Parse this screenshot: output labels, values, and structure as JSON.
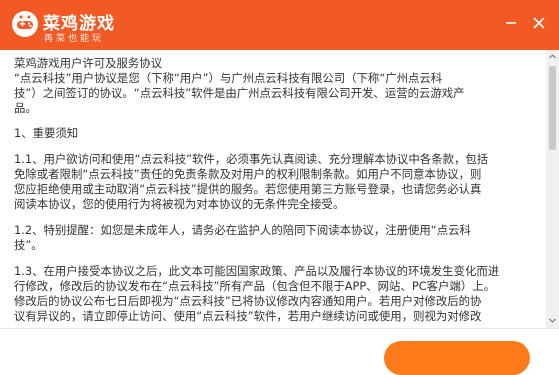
{
  "titlebar": {
    "brand_name": "菜鸡游戏",
    "slogan": "再菜也能玩",
    "accent_color": "#f15a24",
    "icons": [
      "game-controller-logo-icon",
      "minimize-icon",
      "close-icon"
    ]
  },
  "agreement": {
    "lines": [
      "菜鸡游戏用户许可及服务协议",
      "“点云科技”用户协议是您（下称“用户”）与广州点云科技有限公司（下称“广州点云科",
      "技”）之间签订的协议。“点云科技”软件是由广州点云科技有限公司开发、运营的云游戏产",
      "品。",
      "1、重要须知",
      "1.1、用户欲访问和使用“点云科技”软件，必须事先认真阅读、充分理解本协议中各条款，包括",
      "免除或者限制“点云科技”责任的免责条款及对用户的权利限制条款。如用户不同意本协议，则",
      "您应拒绝使用或主动取消“点云科技”提供的服务。若您使用第三方账号登录，也请您务必认真",
      "阅读本协议，您的使用行为将被视为对本协议的无条件完全接受。",
      "1.2、特别提醒：如您是未成年人，请务必在监护人的陪同下阅读本协议，注册使用“点云科",
      "技”。",
      "1.3、在用户接受本协议之后，此文本可能因国家政策、产品以及履行本协议的环境发生变化而进",
      "行修改，修改后的协议发布在“点云科技”所有产品（包含但不限于APP、网站、PC客户端）上。",
      "修改后的协议公布七日后即视为“点云科技”已将协议修改内容通知用户。若用户对修改后的协",
      "议有异议的，请立即停止访问、使用“点云科技”软件，若用户继续访问或使用，则视为对修改"
    ]
  }
}
